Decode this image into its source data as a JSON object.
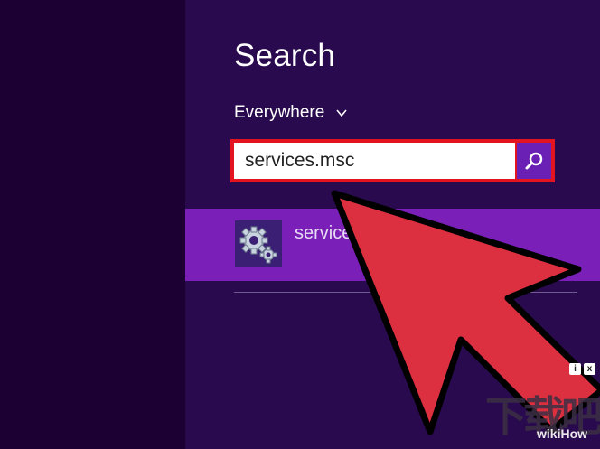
{
  "search_pane": {
    "title": "Search",
    "scope": {
      "label": "Everywhere",
      "icon": "chevron-down-icon"
    },
    "search_box": {
      "value": "services.msc",
      "icon": "search-icon"
    },
    "results": [
      {
        "label": "services",
        "icon": "gear-icon",
        "selected": true
      }
    ]
  },
  "overlay": {
    "ad_badges": [
      "i",
      "x"
    ],
    "watermark_cn": "下载吧",
    "watermark_wikihow": "wikiHow"
  },
  "colors": {
    "page_bg": "#1c0034",
    "pane_bg": "#2a0a4e",
    "selected_row": "#7a1fb8",
    "highlight_border": "#e3141f",
    "arrow_fill": "#dc2f3f"
  }
}
